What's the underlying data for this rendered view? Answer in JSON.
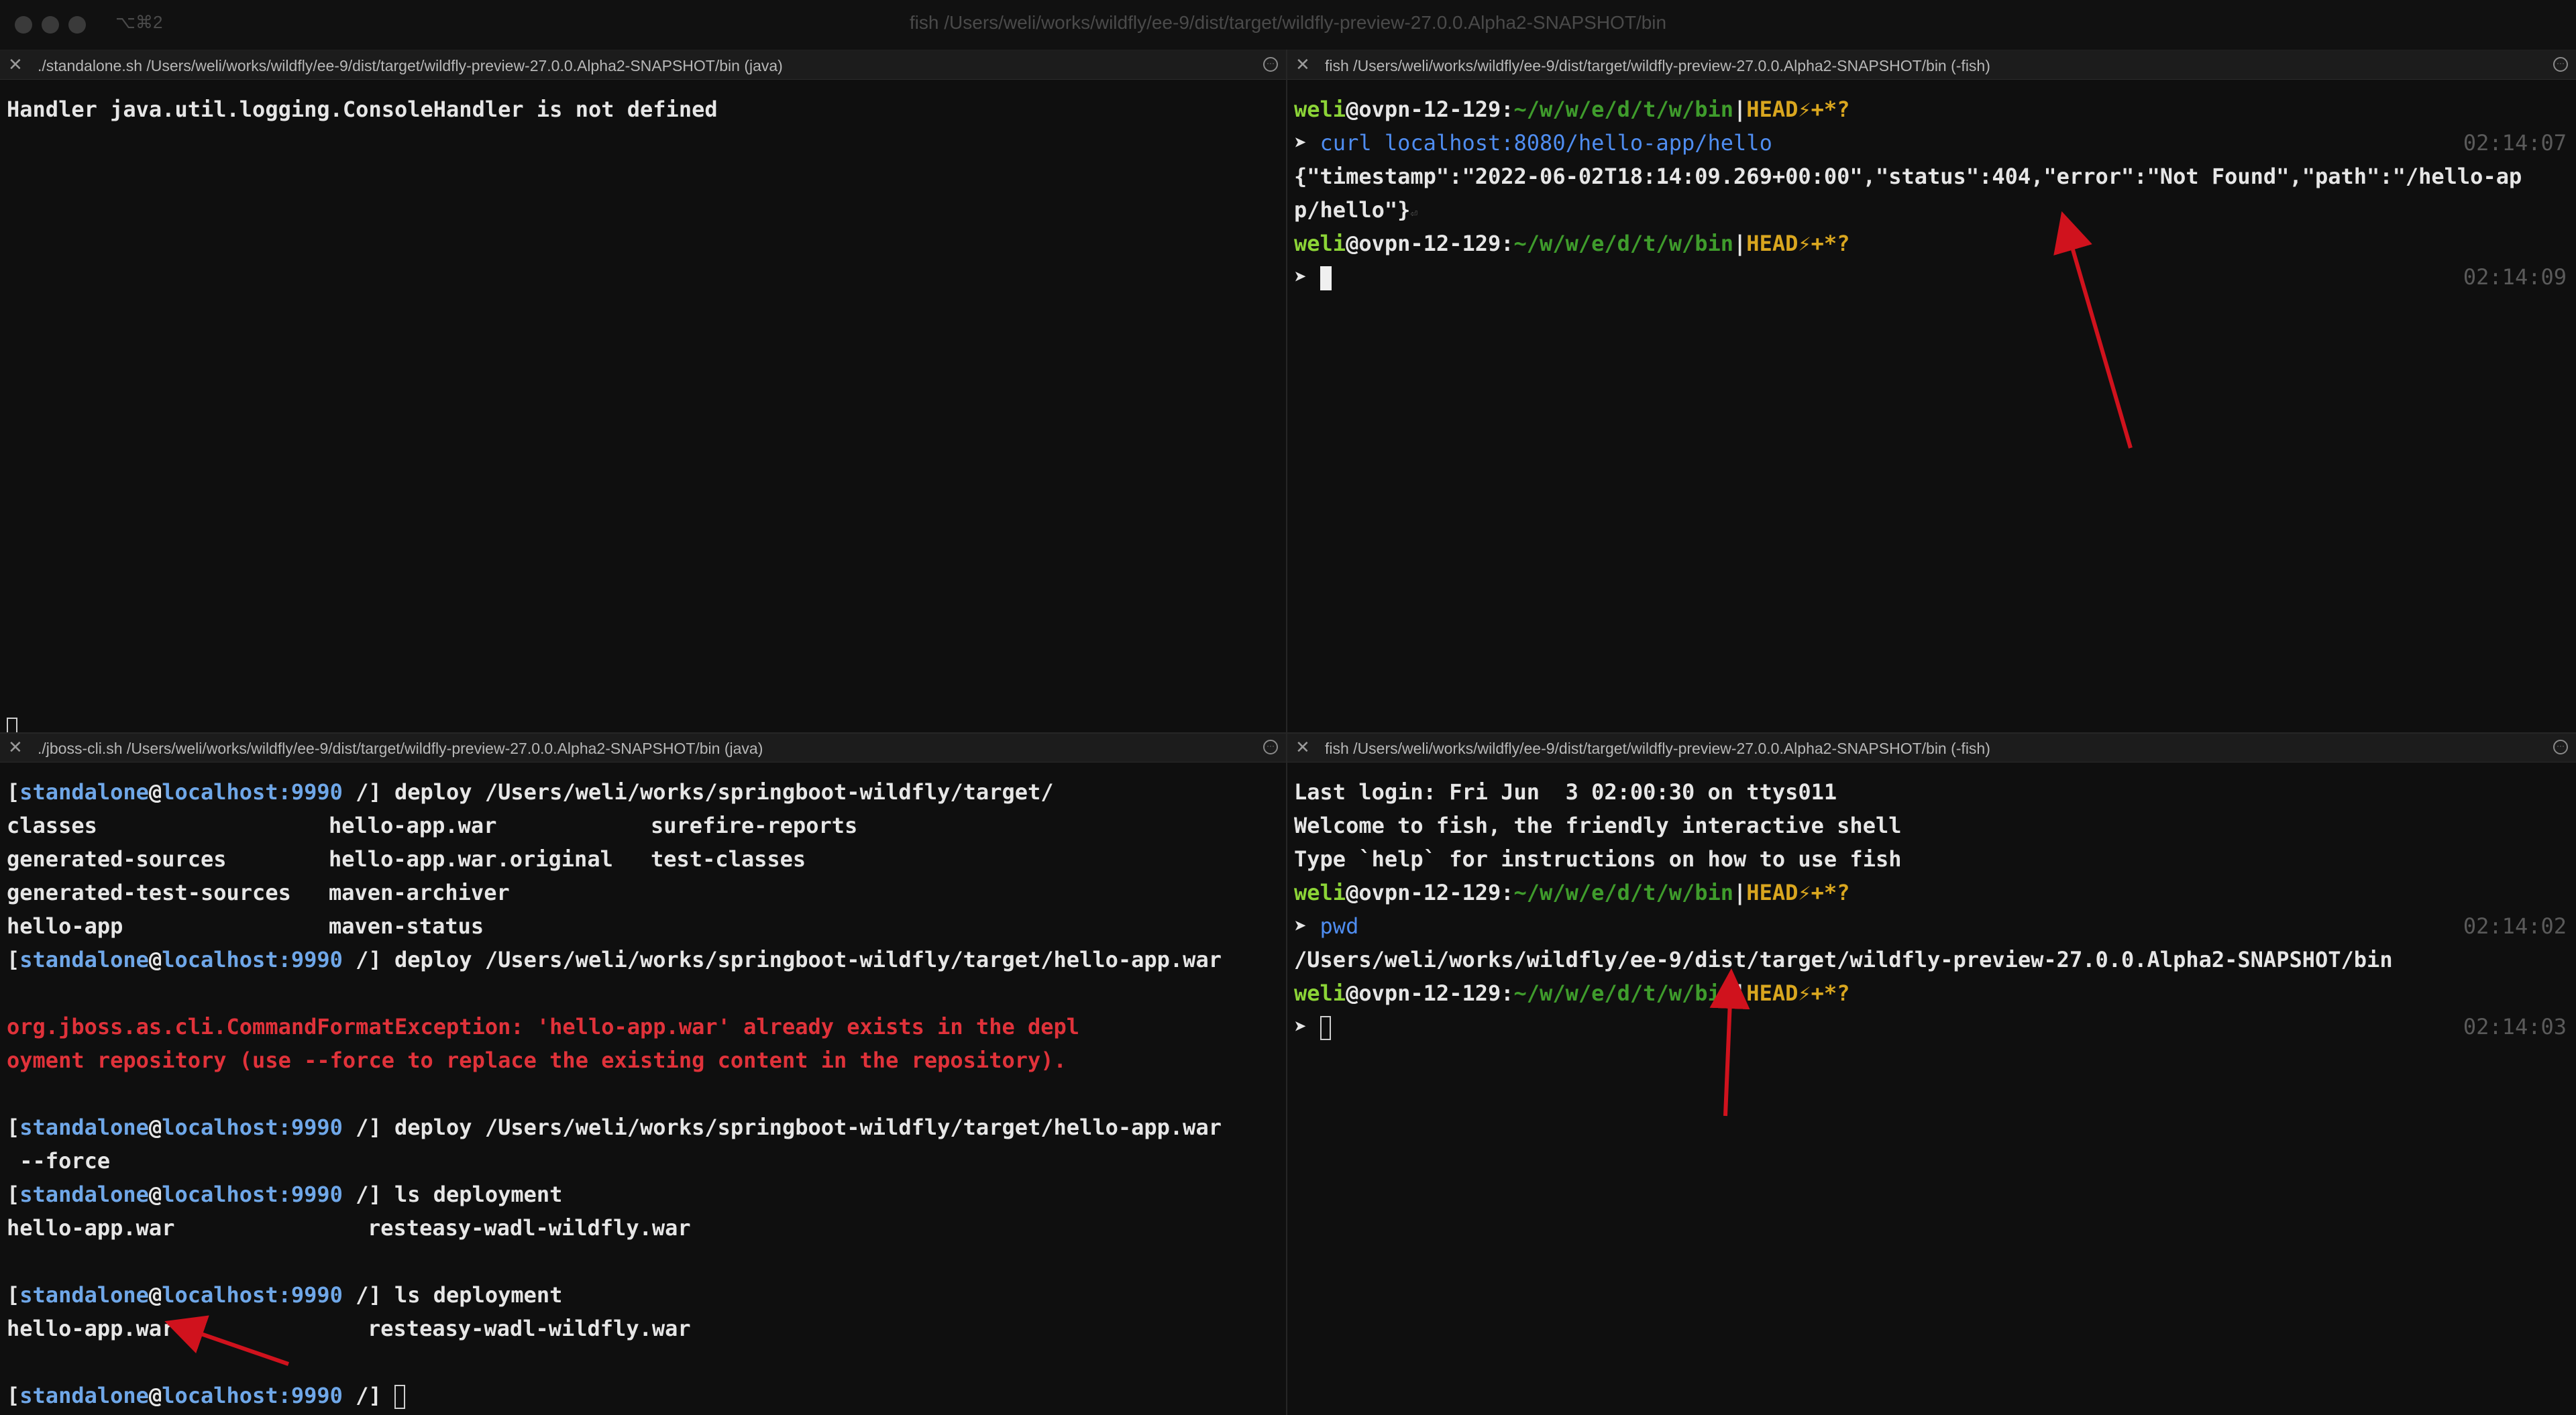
{
  "window": {
    "shortcut": "⌥⌘2",
    "title": "fish /Users/weli/works/wildfly/ee-9/dist/target/wildfly-preview-27.0.0.Alpha2-SNAPSHOT/bin"
  },
  "panes": {
    "top_left": {
      "title": "./standalone.sh /Users/weli/works/wildfly/ee-9/dist/target/wildfly-preview-27.0.0.Alpha2-SNAPSHOT/bin (java)",
      "line1": "Handler java.util.logging.ConsoleHandler is not defined"
    },
    "top_right": {
      "title": "fish /Users/weli/works/wildfly/ee-9/dist/target/wildfly-preview-27.0.0.Alpha2-SNAPSHOT/bin (-fish)",
      "prompt_user": "weli",
      "prompt_at": "@",
      "prompt_host": "ovpn-12-129",
      "prompt_colon": ":",
      "prompt_path": "~/w/w/e/d/t/w/bin",
      "prompt_bar": "|",
      "prompt_branch": "HEAD⚡+*?",
      "prompt_arrow": "➤",
      "command": "curl",
      "command_arg": "localhost:8080/hello-app/hello",
      "time1": "02:14:07",
      "response_line1": "{\"timestamp\":\"2022-06-02T18:14:09.269+00:00\",\"status\":404,\"error\":\"Not Found\",\"path\":\"/hello-ap",
      "response_line2": "p/hello\"}",
      "response_eol": "⏎",
      "time2": "02:14:09"
    },
    "bottom_left": {
      "title": "./jboss-cli.sh /Users/weli/works/wildfly/ee-9/dist/target/wildfly-preview-27.0.0.Alpha2-SNAPSHOT/bin (java)",
      "prompt_open": "[",
      "prompt_user": "standalone",
      "prompt_at": "@",
      "prompt_host": "localhost:9990",
      "prompt_close": " /]",
      "cmd_deploy_dir": " deploy /Users/weli/works/springboot-wildfly/target/",
      "listing": [
        [
          "classes",
          "hello-app.war",
          "surefire-reports"
        ],
        [
          "generated-sources",
          "hello-app.war.original",
          "test-classes"
        ],
        [
          "generated-test-sources",
          "maven-archiver",
          ""
        ],
        [
          "hello-app",
          "maven-status",
          ""
        ]
      ],
      "cmd_deploy_war": " deploy /Users/weli/works/springboot-wildfly/target/hello-app.war",
      "error_line1": "org.jboss.as.cli.CommandFormatException: 'hello-app.war' already exists in the depl",
      "error_line2": "oyment repository (use --force to replace the existing content in the repository).",
      "cmd_deploy_force_a": " deploy /Users/weli/works/springboot-wildfly/target/hello-app.war",
      "cmd_deploy_force_b": " --force",
      "cmd_ls": " ls deployment",
      "deployment_1": "hello-app.war",
      "deployment_2": "resteasy-wadl-wildfly.war"
    },
    "bottom_right": {
      "title": "fish /Users/weli/works/wildfly/ee-9/dist/target/wildfly-preview-27.0.0.Alpha2-SNAPSHOT/bin (-fish)",
      "last_login": "Last login: Fri Jun  3 02:00:30 on ttys011",
      "welcome": "Welcome to fish, the friendly interactive shell",
      "help": "Type `help` for instructions on how to use fish",
      "command": "pwd",
      "time1": "02:14:02",
      "pwd_output": "/Users/weli/works/wildfly/ee-9/dist/target/wildfly-preview-27.0.0.Alpha2-SNAPSHOT/bin",
      "time2": "02:14:03"
    }
  },
  "colors": {
    "background": "#0f0f0f",
    "user_green": "#8cd437",
    "path_green": "#3f9c2c",
    "branch_yellow": "#d9a61f",
    "command_blue": "#4f8df0",
    "cli_blue": "#6fa7e8",
    "error_red": "#e0323a",
    "annotation_arrow": "#d0121d"
  },
  "icons": {
    "pane_close": "close-icon",
    "pane_menu": "more-options-icon"
  }
}
